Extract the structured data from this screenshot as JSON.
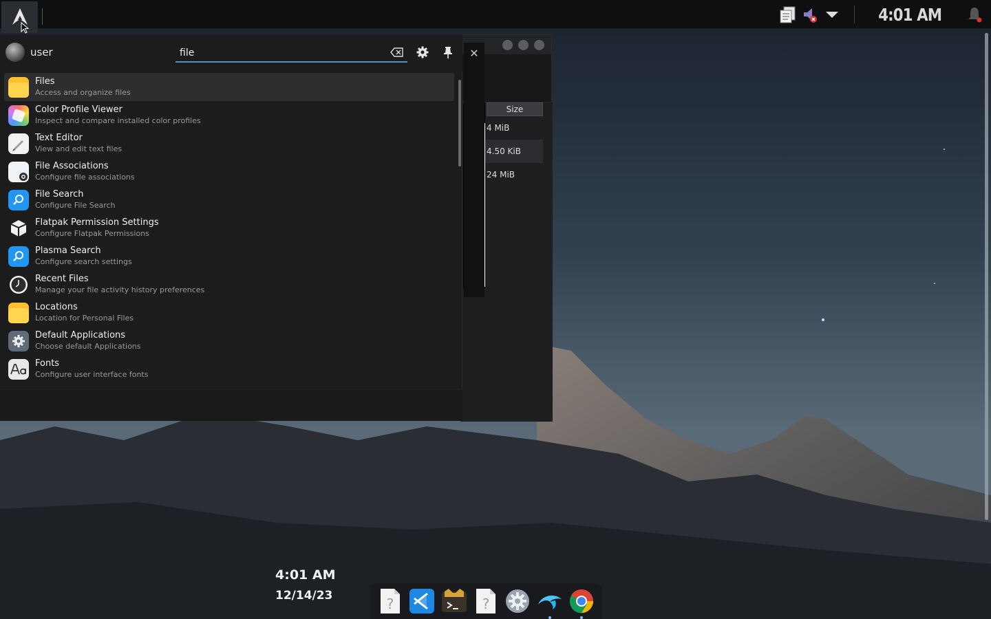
{
  "panel": {
    "clock": "4:01 AM"
  },
  "launcher": {
    "user": "user",
    "search": {
      "value": "file",
      "placeholder": ""
    },
    "results": [
      {
        "title": "Files",
        "desc": "Access and organize files",
        "icon": "folder-icon"
      },
      {
        "title": "Color Profile Viewer",
        "desc": "Inspect and compare installed color profiles",
        "icon": "color-profile-icon"
      },
      {
        "title": "Text Editor",
        "desc": "View and edit text files",
        "icon": "text-editor-icon"
      },
      {
        "title": "File Associations",
        "desc": "Configure file associations",
        "icon": "file-associations-icon"
      },
      {
        "title": "File Search",
        "desc": "Configure File Search",
        "icon": "file-search-icon"
      },
      {
        "title": "Flatpak Permission Settings",
        "desc": "Configure Flatpak Permissions",
        "icon": "flatpak-icon"
      },
      {
        "title": "Plasma Search",
        "desc": "Configure search settings",
        "icon": "plasma-search-icon"
      },
      {
        "title": "Recent Files",
        "desc": "Manage your file activity history preferences",
        "icon": "clock-icon"
      },
      {
        "title": "Locations",
        "desc": "Location for Personal Files",
        "icon": "folder-icon"
      },
      {
        "title": "Default Applications",
        "desc": "Choose default Applications",
        "icon": "gear-icon"
      },
      {
        "title": "Fonts",
        "desc": "Configure user interface fonts",
        "icon": "fonts-icon"
      }
    ]
  },
  "file_manager": {
    "column_header": "Size",
    "sizes": [
      "4 MiB",
      "4.50 KiB",
      "24 MiB"
    ]
  },
  "desktop_clock": {
    "time": "4:01 AM",
    "date": "12/14/23"
  },
  "dock": {
    "items": [
      "unknown-app-icon",
      "vscode-icon",
      "terminal-icon",
      "unknown-app-icon",
      "system-settings-icon",
      "dolphin-icon",
      "chrome-icon"
    ]
  },
  "colors": {
    "accent": "#5b8ec4",
    "panel_bg": "#0e0f10",
    "launcher_bg": "#1c1c1c"
  }
}
